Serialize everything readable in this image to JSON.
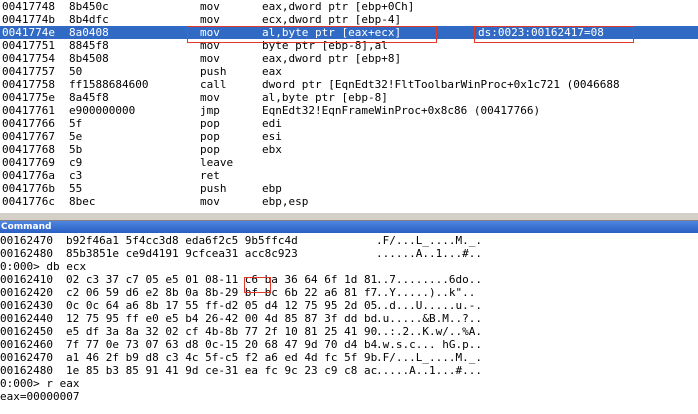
{
  "disassembly": [
    {
      "addr": "00417748",
      "bytes": "8b450c",
      "mnemonic": "mov",
      "operands": "eax,dword ptr [ebp+0Ch]",
      "extra": ""
    },
    {
      "addr": "0041774b",
      "bytes": "8b4dfc",
      "mnemonic": "mov",
      "operands": "ecx,dword ptr [ebp-4]",
      "extra": ""
    },
    {
      "addr": "0041774e",
      "bytes": "8a0408",
      "mnemonic": "mov",
      "operands": "al,byte ptr [eax+ecx]",
      "extra": "ds:0023:00162417=08",
      "selected": true
    },
    {
      "addr": "00417751",
      "bytes": "8845f8",
      "mnemonic": "mov",
      "operands": "byte ptr [ebp-8],al",
      "extra": ""
    },
    {
      "addr": "00417754",
      "bytes": "8b4508",
      "mnemonic": "mov",
      "operands": "eax,dword ptr [ebp+8]",
      "extra": ""
    },
    {
      "addr": "00417757",
      "bytes": "50",
      "mnemonic": "push",
      "operands": "eax",
      "extra": ""
    },
    {
      "addr": "00417758",
      "bytes": "ff1588684600",
      "mnemonic": "call",
      "operands": "dword ptr [EqnEdt32!FltToolbarWinProc+0x1c721 (0046688",
      "extra": ""
    },
    {
      "addr": "0041775e",
      "bytes": "8a45f8",
      "mnemonic": "mov",
      "operands": "al,byte ptr [ebp-8]",
      "extra": ""
    },
    {
      "addr": "00417761",
      "bytes": "e900000000",
      "mnemonic": "jmp",
      "operands": "EqnEdt32!EqnFrameWinProc+0x8c86 (00417766)",
      "extra": ""
    },
    {
      "addr": "00417766",
      "bytes": "5f",
      "mnemonic": "pop",
      "operands": "edi",
      "extra": ""
    },
    {
      "addr": "00417767",
      "bytes": "5e",
      "mnemonic": "pop",
      "operands": "esi",
      "extra": ""
    },
    {
      "addr": "00417768",
      "bytes": "5b",
      "mnemonic": "pop",
      "operands": "ebx",
      "extra": ""
    },
    {
      "addr": "00417769",
      "bytes": "c9",
      "mnemonic": "leave",
      "operands": "",
      "extra": ""
    },
    {
      "addr": "0041776a",
      "bytes": "c3",
      "mnemonic": "ret",
      "operands": "",
      "extra": ""
    },
    {
      "addr": "0041776b",
      "bytes": "55",
      "mnemonic": "push",
      "operands": "ebp",
      "extra": ""
    },
    {
      "addr": "0041776c",
      "bytes": "8bec",
      "mnemonic": "mov",
      "operands": "ebp,esp",
      "extra": ""
    }
  ],
  "command_window": {
    "title": "Command",
    "lines": [
      {
        "kind": "dd",
        "addr": "00162470",
        "hex": "b92f46a1 5f4cc3d8 eda6f2c5 9b5ffc4d",
        "ascii": ".F/...L_....M._."
      },
      {
        "kind": "dd",
        "addr": "00162480",
        "hex": "85b3851e ce9d4191 9cfcea31 acc8c923",
        "ascii": "......A..1...#.."
      },
      {
        "kind": "text",
        "text": "0:000> db ecx"
      },
      {
        "kind": "db",
        "addr": "00162410",
        "hex": "02 c3 37 c7 05 e5 01 08-11 c6 ba 36 64 6f 1d 81",
        "ascii": "..7........6do.."
      },
      {
        "kind": "db",
        "addr": "00162420",
        "hex": "c2 06 59 d6 e2 8b 0a 8b-29 bf bc 6b 22 a6 81 f7",
        "ascii": "..Y.....)..k\".."
      },
      {
        "kind": "db",
        "addr": "00162430",
        "hex": "0c 0c 64 a6 8b 17 55 ff-d2 05 d4 12 75 95 2d 05",
        "ascii": "..d...U.....u.-."
      },
      {
        "kind": "db",
        "addr": "00162440",
        "hex": "12 75 95 ff e0 e5 b4 26-42 00 4d 85 87 3f dd bd",
        "ascii": ".u.....&B.M..?.."
      },
      {
        "kind": "db",
        "addr": "00162450",
        "hex": "e5 df 3a 8a 32 02 cf 4b-8b 77 2f 10 81 25 41 90",
        "ascii": "..:.2..K.w/..%A."
      },
      {
        "kind": "db",
        "addr": "00162460",
        "hex": "7f 77 0e 73 07 63 d8 0c-15 20 68 47 9d 70 d4 b4",
        "ascii": ".w.s.c... hG.p.."
      },
      {
        "kind": "db",
        "addr": "00162470",
        "hex": "a1 46 2f b9 d8 c3 4c 5f-c5 f2 a6 ed 4d fc 5f 9b",
        "ascii": ".F/...L_....M._."
      },
      {
        "kind": "db",
        "addr": "00162480",
        "hex": "1e 85 b3 85 91 41 9d ce-31 ea fc 9c 23 c9 c8 ac",
        "ascii": ".....A..1...#..."
      },
      {
        "kind": "text",
        "text": "0:000> r eax"
      },
      {
        "kind": "text",
        "text": "eax=00000007"
      }
    ]
  }
}
